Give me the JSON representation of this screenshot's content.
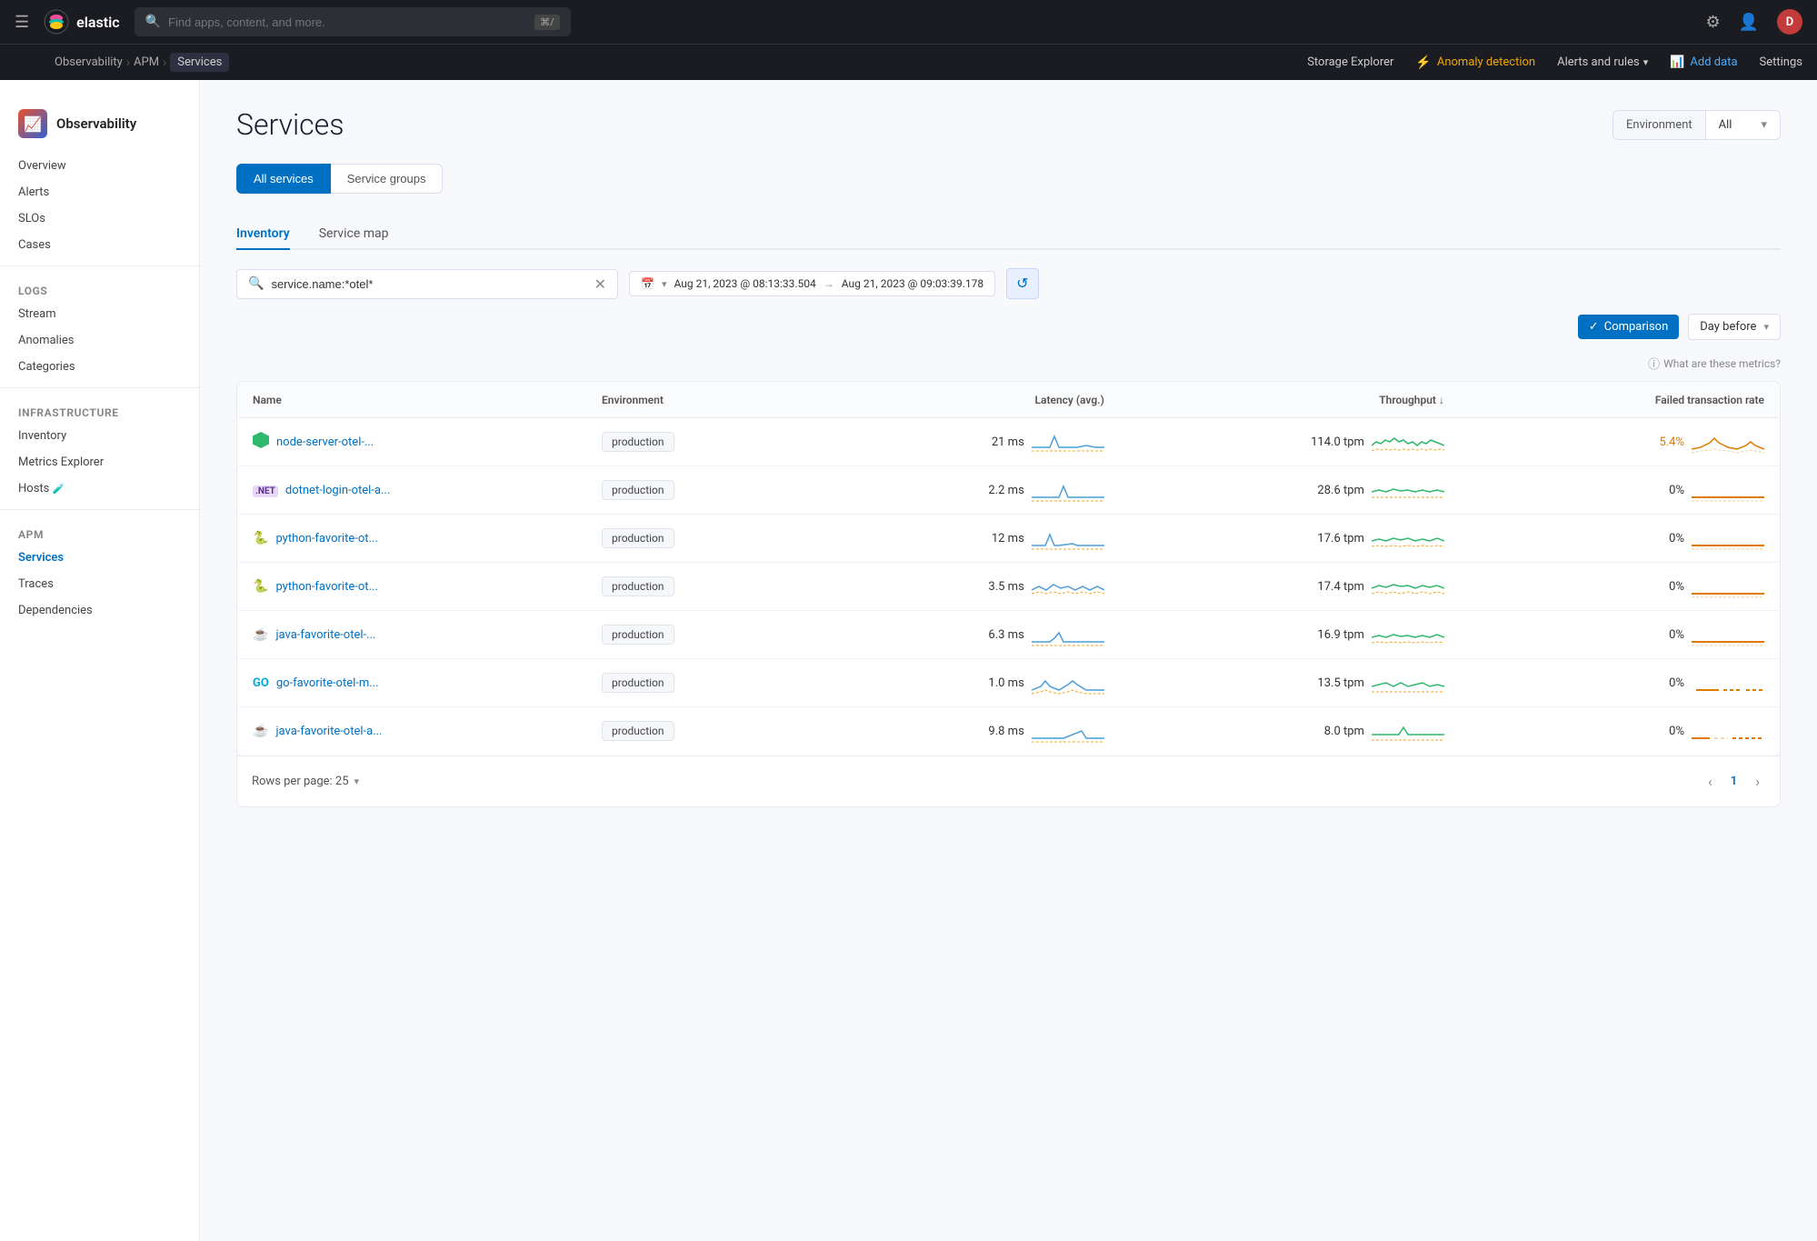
{
  "topnav": {
    "logo_text": "elastic",
    "search_placeholder": "Find apps, content, and more.",
    "search_shortcut": "⌘/",
    "user_initial": "D",
    "icons": [
      "settings-icon",
      "people-icon"
    ]
  },
  "breadcrumb": {
    "items": [
      {
        "label": "Observability",
        "active": false
      },
      {
        "label": "APM",
        "active": false
      },
      {
        "label": "Services",
        "active": true
      }
    ],
    "right": {
      "storage_explorer": "Storage Explorer",
      "anomaly_detection": "Anomaly detection",
      "alerts_and_rules": "Alerts and rules",
      "add_data": "Add data",
      "settings": "Settings"
    }
  },
  "sidebar": {
    "logo": "Observability",
    "items": [
      {
        "label": "Overview",
        "section": ""
      },
      {
        "label": "Alerts",
        "section": ""
      },
      {
        "label": "SLOs",
        "section": ""
      },
      {
        "label": "Cases",
        "section": ""
      },
      {
        "label": "Logs",
        "section": "section",
        "is_section": true
      },
      {
        "label": "Stream",
        "section": "Logs"
      },
      {
        "label": "Anomalies",
        "section": "Logs"
      },
      {
        "label": "Categories",
        "section": "Logs"
      },
      {
        "label": "Infrastructure",
        "section": "section",
        "is_section": true
      },
      {
        "label": "Inventory",
        "section": "Infrastructure"
      },
      {
        "label": "Metrics Explorer",
        "section": "Infrastructure"
      },
      {
        "label": "Hosts",
        "section": "Infrastructure"
      },
      {
        "label": "APM",
        "section": "section",
        "is_section": true
      },
      {
        "label": "Services",
        "section": "APM",
        "active": true
      },
      {
        "label": "Traces",
        "section": "APM"
      },
      {
        "label": "Dependencies",
        "section": "APM"
      }
    ]
  },
  "page": {
    "title": "Services",
    "environment_label": "Environment",
    "environment_value": "All",
    "tab_buttons": [
      {
        "label": "All services",
        "active": true
      },
      {
        "label": "Service groups",
        "active": false
      }
    ],
    "inventory_tabs": [
      {
        "label": "Inventory",
        "active": true
      },
      {
        "label": "Service map",
        "active": false
      }
    ],
    "search_value": "service.name:*otel*",
    "date_from": "Aug 21, 2023 @ 08:13:33.504",
    "date_to": "Aug 21, 2023 @ 09:03:39.178",
    "comparison_label": "Comparison",
    "comparison_period": "Day before",
    "metrics_help": "What are these metrics?",
    "table": {
      "headers": [
        "Name",
        "Environment",
        "Latency (avg.)",
        "Throughput ↓",
        "Failed transaction rate"
      ],
      "rows": [
        {
          "icon": "hex",
          "name": "node-server-otel-...",
          "env": "production",
          "latency": "21 ms",
          "throughput": "114.0 tpm",
          "failed_rate": "5.4%",
          "failed_color": "orange"
        },
        {
          "icon": "net",
          "name": "dotnet-login-otel-a...",
          "env": "production",
          "latency": "2.2 ms",
          "throughput": "28.6 tpm",
          "failed_rate": "0%",
          "failed_color": "normal"
        },
        {
          "icon": "python",
          "name": "python-favorite-ot...",
          "env": "production",
          "latency": "12 ms",
          "throughput": "17.6 tpm",
          "failed_rate": "0%",
          "failed_color": "normal"
        },
        {
          "icon": "python",
          "name": "python-favorite-ot...",
          "env": "production",
          "latency": "3.5 ms",
          "throughput": "17.4 tpm",
          "failed_rate": "0%",
          "failed_color": "normal"
        },
        {
          "icon": "java",
          "name": "java-favorite-otel-...",
          "env": "production",
          "latency": "6.3 ms",
          "throughput": "16.9 tpm",
          "failed_rate": "0%",
          "failed_color": "normal"
        },
        {
          "icon": "go",
          "name": "go-favorite-otel-m...",
          "env": "production",
          "latency": "1.0 ms",
          "throughput": "13.5 tpm",
          "failed_rate": "0%",
          "failed_color": "normal"
        },
        {
          "icon": "java",
          "name": "java-favorite-otel-a...",
          "env": "production",
          "latency": "9.8 ms",
          "throughput": "8.0 tpm",
          "failed_rate": "0%",
          "failed_color": "normal"
        }
      ]
    },
    "rows_per_page": "Rows per page: 25",
    "current_page": "1"
  }
}
